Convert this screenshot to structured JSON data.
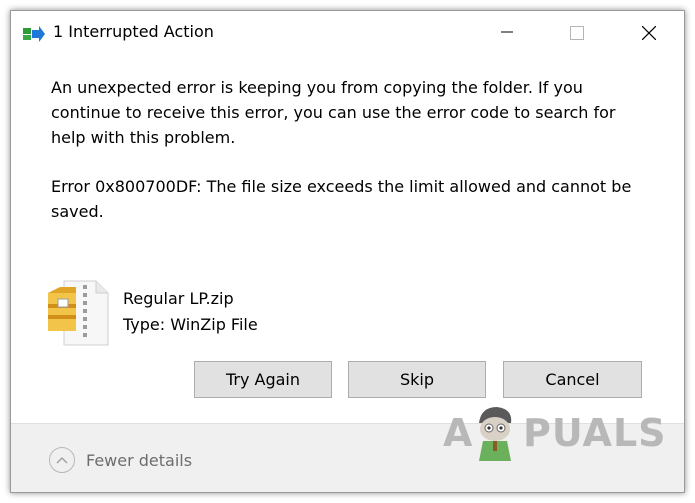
{
  "window": {
    "title": "1 Interrupted Action"
  },
  "message": {
    "line1": "An unexpected error is keeping you from copying the folder. If you continue to receive this error, you can use the error code to search for help with this problem.",
    "line2": "Error 0x800700DF: The file size exceeds the limit allowed and cannot be saved."
  },
  "file": {
    "name": "Regular LP.zip",
    "type": "Type: WinZip File",
    "icon": "zip-archive-icon"
  },
  "buttons": {
    "try_again": "Try Again",
    "skip": "Skip",
    "cancel": "Cancel"
  },
  "footer": {
    "fewer_details": "Fewer details"
  },
  "watermark": {
    "brand_left": "A",
    "brand_right": "PUALS"
  },
  "colors": {
    "button_bg": "#e1e1e1",
    "button_border": "#adadad",
    "footer_bg": "#f0f0f0",
    "muted_text": "#6d6d6d",
    "icon_green": "#2e9b3a",
    "icon_blue": "#1e78d8"
  }
}
